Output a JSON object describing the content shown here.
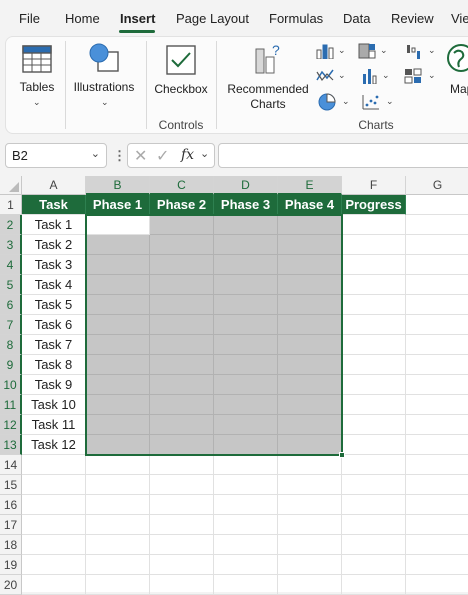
{
  "menu": {
    "tabs": [
      {
        "label": "File"
      },
      {
        "label": "Home"
      },
      {
        "label": "Insert"
      },
      {
        "label": "Page Layout"
      },
      {
        "label": "Formulas"
      },
      {
        "label": "Data"
      },
      {
        "label": "Review"
      },
      {
        "label": "Vie"
      }
    ],
    "active_tab": "Insert"
  },
  "ribbon": {
    "tables_label": "Tables",
    "illustrations_label": "Illustrations",
    "checkbox_label": "Checkbox",
    "controls_group": "Controls",
    "recommended_charts_line1": "Recommended",
    "recommended_charts_line2": "Charts",
    "charts_group": "Charts",
    "maps_label": "Map"
  },
  "formula_bar": {
    "name_box": "B2",
    "fx_label": "fx",
    "formula": ""
  },
  "sheet": {
    "columns": [
      "A",
      "B",
      "C",
      "D",
      "E",
      "F",
      "G"
    ],
    "rows": [
      "1",
      "2",
      "3",
      "4",
      "5",
      "6",
      "7",
      "8",
      "9",
      "10",
      "11",
      "12",
      "13",
      "14",
      "15",
      "16",
      "17",
      "18",
      "19",
      "20"
    ],
    "headers": [
      "Task",
      "Phase 1",
      "Phase 2",
      "Phase 3",
      "Phase 4",
      "Progress"
    ],
    "tasks": [
      "Task 1",
      "Task 2",
      "Task 3",
      "Task 4",
      "Task 5",
      "Task 6",
      "Task 7",
      "Task 8",
      "Task 9",
      "Task 10",
      "Task 11",
      "Task 12"
    ],
    "active_cell": "B2",
    "selection": "B2:E13"
  },
  "colors": {
    "accent": "#1e6b3b",
    "header_fill": "#1e6b3b",
    "selection_fill": "#c6c6c6"
  }
}
